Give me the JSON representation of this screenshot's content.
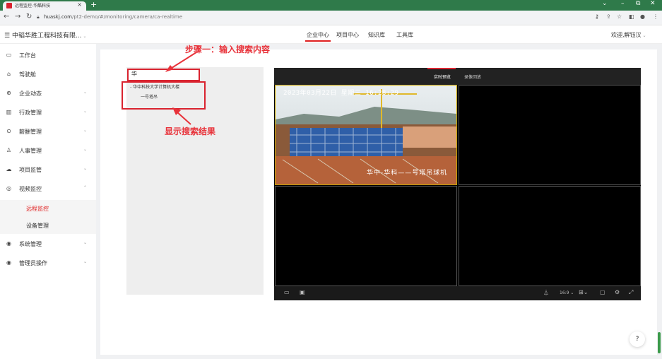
{
  "browser": {
    "tab_title": "远程监控-华酷科技",
    "url_host": "huaskj.com",
    "url_path": "/pt2-demo/#/monitoring/camera/ca-realtime"
  },
  "app": {
    "brand": "中韬华胜工程科技有限...",
    "top_nav": [
      "企业中心",
      "项目中心",
      "知识库",
      "工具库"
    ],
    "welcome": "欢迎,解钰汉"
  },
  "sidebar": {
    "items": [
      {
        "label": "工作台",
        "icon": "monitor-icon"
      },
      {
        "label": "驾驶舱",
        "icon": "home-icon"
      },
      {
        "label": "企业动态",
        "icon": "globe-icon"
      },
      {
        "label": "行政管理",
        "icon": "chart-icon"
      },
      {
        "label": "薪酬管理",
        "icon": "money-icon"
      },
      {
        "label": "人事管理",
        "icon": "user-icon"
      },
      {
        "label": "项目监管",
        "icon": "cloud-icon"
      },
      {
        "label": "视频监控",
        "icon": "location-icon"
      },
      {
        "label": "系统管理",
        "icon": "settings-icon"
      },
      {
        "label": "管理员操作",
        "icon": "admin-icon"
      }
    ],
    "sub_items": [
      "远程监控",
      "设备管理"
    ]
  },
  "tree": {
    "search_value": "华",
    "node_parent": "华中科技大学计算机大楼",
    "node_child": "一号塔吊"
  },
  "annotations": {
    "step1": "步骤一：输入搜索内容",
    "result": "显示搜索结果"
  },
  "player": {
    "tabs": [
      "实时预览",
      "录像回放"
    ],
    "timestamp": "2023年03月22日 星期三 16:28:29",
    "camera_label": "华中-华科——号塔吊球机",
    "ratio": "16:9"
  },
  "help": "?"
}
